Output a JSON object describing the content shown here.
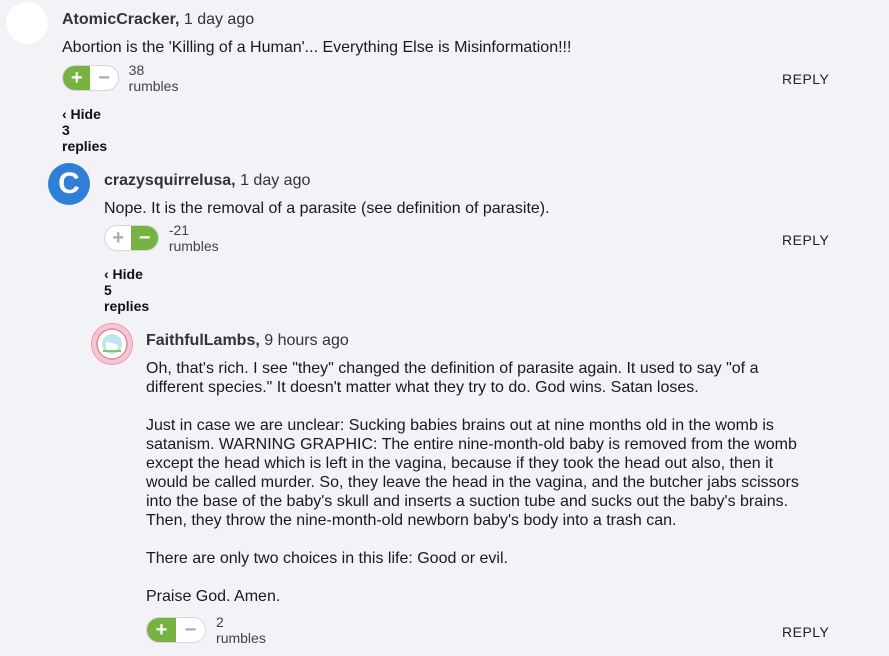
{
  "comments": [
    {
      "username": "AtomicCracker,",
      "time": "1 day ago",
      "text": [
        "Abortion is the 'Killing of a Human'... Everything Else is Misinformation!!!"
      ],
      "vote_state": "up",
      "plus": "+",
      "minus": "−",
      "rumbles": "38 rumbles",
      "reply": "REPLY",
      "toggle": "‹ Hide 3 replies"
    },
    {
      "username": "crazysquirrelusa,",
      "time": "1 day ago",
      "avatar_letter": "C",
      "text": [
        "Nope. It is the removal of a parasite (see definition of parasite)."
      ],
      "vote_state": "down",
      "plus": "+",
      "minus": "−",
      "rumbles": "-21 rumbles",
      "reply": "REPLY",
      "toggle": "‹ Hide 5 replies"
    },
    {
      "username": "FaithfulLambs,",
      "time": "9 hours ago",
      "text": [
        "Oh, that's rich. I see \"they\" changed the definition of parasite again. It used to say \"of a different species.\" It doesn't matter what they try to do. God wins. Satan loses.",
        "Just in case we are unclear: Sucking babies brains out at nine months old in the womb is satanism. WARNING GRAPHIC: The entire nine-month-old baby is removed from the womb except the head which is left in the vagina, because if they took the head out also, then it would be called murder. So, they leave the head in the vagina, and the butcher jabs scissors into the base of the baby's skull and inserts a suction tube and sucks out the baby's brains. Then, they throw the nine-month-old newborn baby's body into a trash can.",
        "There are only two choices in this life: Good or evil.",
        "Praise God. Amen."
      ],
      "vote_state": "up",
      "plus": "+",
      "minus": "−",
      "rumbles": "2 rumbles",
      "reply": "REPLY"
    }
  ],
  "colors": {
    "background": "#f2f2f7",
    "vote_active": "#78b243",
    "avatar_blue": "#2f7fd6"
  }
}
